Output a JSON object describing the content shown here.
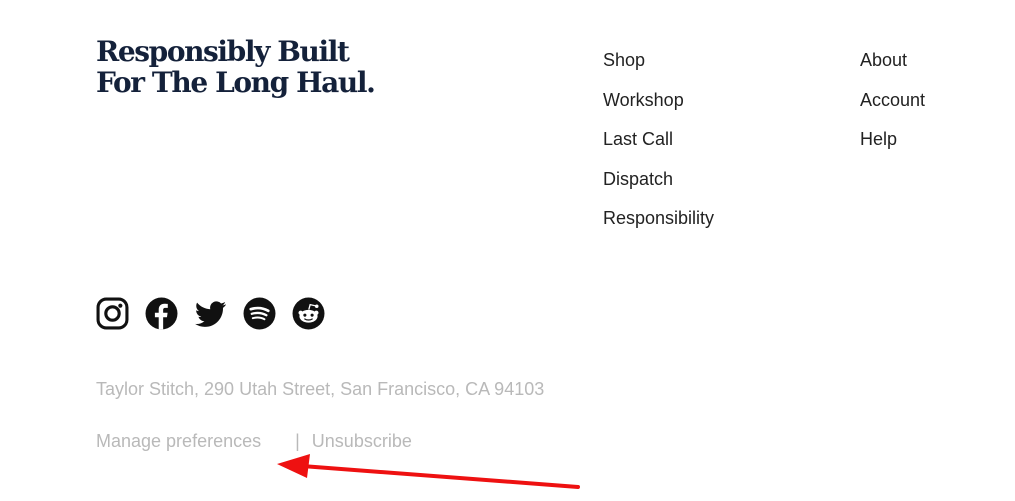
{
  "tagline": {
    "line1": "Responsibly Built",
    "line2": "For The Long Haul."
  },
  "nav": {
    "column1": [
      "Shop",
      "Workshop",
      "Last Call",
      "Dispatch",
      "Responsibility"
    ],
    "column2": [
      "About",
      "Account",
      "Help"
    ]
  },
  "social": [
    "instagram-icon",
    "facebook-icon",
    "twitter-icon",
    "spotify-icon",
    "reddit-icon"
  ],
  "footer": {
    "address": "Taylor Stitch, 290 Utah Street, San Francisco, CA 94103",
    "manage_label": "Manage preferences",
    "separator": "|",
    "unsubscribe_label": "Unsubscribe"
  },
  "colors": {
    "heading": "#14213a",
    "link": "#222222",
    "muted": "#b9b9b9",
    "arrow": "#ee1111"
  }
}
